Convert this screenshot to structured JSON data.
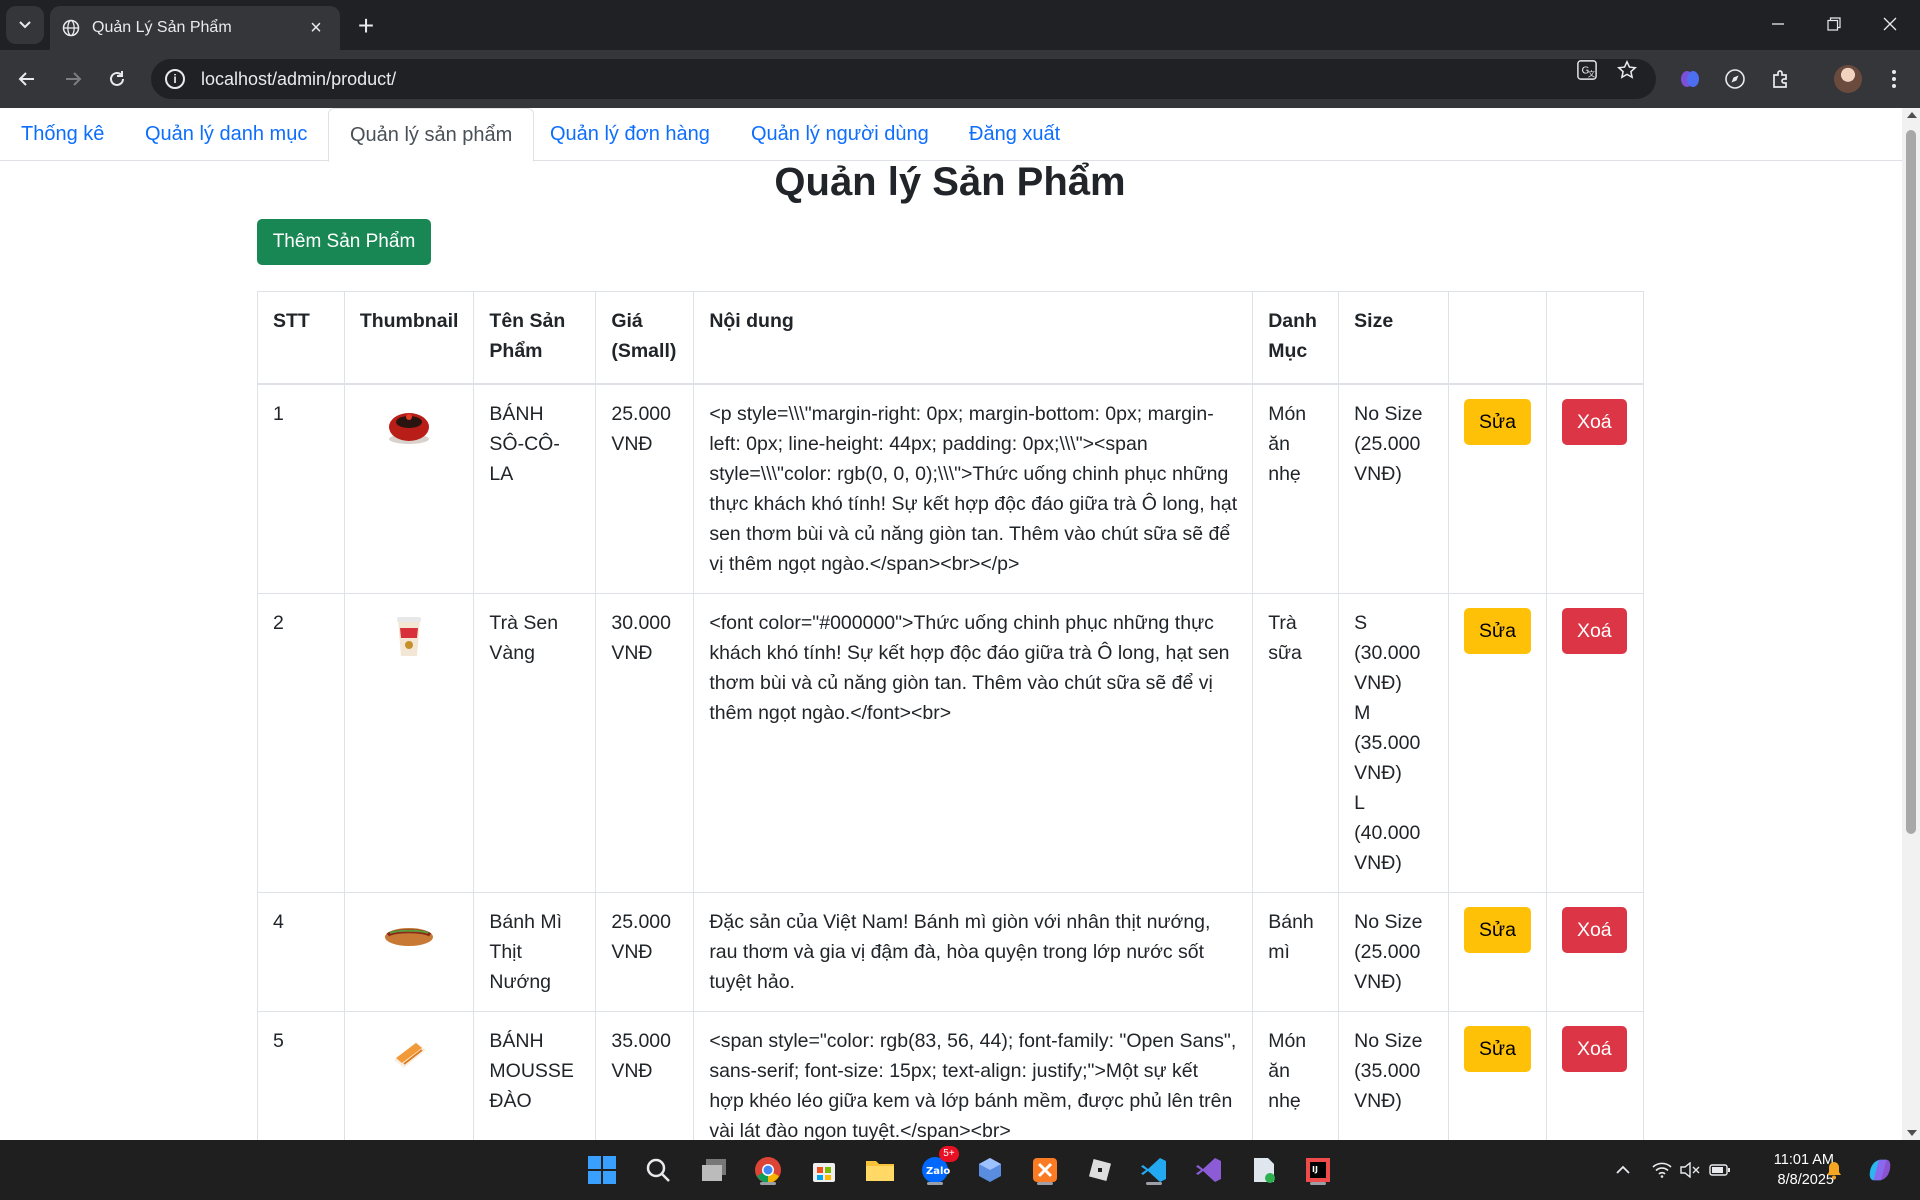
{
  "browser": {
    "tab_title": "Quản Lý Sản Phẩm",
    "url": "localhost/admin/product/"
  },
  "nav": {
    "items": [
      {
        "label": "Thống kê",
        "active": false
      },
      {
        "label": "Quản lý danh mục",
        "active": false
      },
      {
        "label": "Quản lý sản phẩm",
        "active": true
      },
      {
        "label": "Quản lý đơn hàng",
        "active": false
      },
      {
        "label": "Quản lý người dùng",
        "active": false
      },
      {
        "label": "Đăng xuất",
        "active": false
      }
    ]
  },
  "page": {
    "title": "Quản lý Sản Phẩm",
    "add_button": "Thêm Sản Phẩm"
  },
  "table": {
    "headers": [
      "STT",
      "Thumbnail",
      "Tên Sản Phẩm",
      "Giá (Small)",
      "Nội dung",
      "Danh Mục",
      "Size",
      "",
      ""
    ],
    "edit_label": "Sửa",
    "delete_label": "Xoá",
    "rows": [
      {
        "stt": "1",
        "thumbnail": "chocolate-cake-icon",
        "name": "BÁNH SÔ-CÔ-LA",
        "price": "25.000 VNĐ",
        "content": "<p style=\\\\\\\"margin-right: 0px; margin-bottom: 0px; margin-left: 0px; line-height: 44px; padding: 0px;\\\\\\\"><span style=\\\\\\\"color: rgb(0, 0, 0);\\\\\\\">Thức uống chinh phục những thực khách khó tính! Sự kết hợp độc đáo giữa trà Ô long, hạt sen thơm bùi và củ năng giòn tan. Thêm vào chút sữa sẽ để vị thêm ngọt ngào.</span><br></p>",
        "category": "Món ăn nhẹ",
        "sizes": [
          "No Size (25.000 VNĐ)"
        ]
      },
      {
        "stt": "2",
        "thumbnail": "lotus-tea-cup-icon",
        "name": "Trà Sen Vàng",
        "price": "30.000 VNĐ",
        "content": "<font color=\"#000000\">Thức uống chinh phục những thực khách khó tính! Sự kết hợp độc đáo giữa trà Ô long, hạt sen thơm bùi và củ năng giòn tan. Thêm vào chút sữa sẽ để vị thêm ngọt ngào.</font><br>",
        "category": "Trà sữa",
        "sizes": [
          "S (30.000 VNĐ)",
          "M (35.000 VNĐ)",
          "L (40.000 VNĐ)"
        ]
      },
      {
        "stt": "4",
        "thumbnail": "banh-mi-icon",
        "name": "Bánh Mì Thịt Nướng",
        "price": "25.000 VNĐ",
        "content": "Đặc sản của Việt Nam! Bánh mì giòn với nhân thịt nướng, rau thơm và gia vị đậm đà, hòa quyện trong lớp nước sốt tuyệt hảo.",
        "category": "Bánh mì",
        "sizes": [
          "No Size (25.000 VNĐ)"
        ]
      },
      {
        "stt": "5",
        "thumbnail": "peach-mousse-icon",
        "name": "BÁNH MOUSSE ĐÀO",
        "price": "35.000 VNĐ",
        "content": "<span style=\"color: rgb(83, 56, 44); font-family: \"Open Sans\", sans-serif; font-size: 15px; text-align: justify;\">Một sự kết hợp khéo léo giữa kem và lớp bánh mềm, được phủ lên trên vài lát đào ngon tuyệt.</span><br>",
        "category": "Món ăn nhẹ",
        "sizes": [
          "No Size (35.000 VNĐ)"
        ]
      }
    ]
  },
  "taskbar": {
    "time": "11:01 AM",
    "date": "8/8/2025",
    "zalo_badge": "5+"
  },
  "colors": {
    "link": "#0d6efd",
    "success": "#198754",
    "warning": "#ffc107",
    "danger": "#dc3545"
  }
}
